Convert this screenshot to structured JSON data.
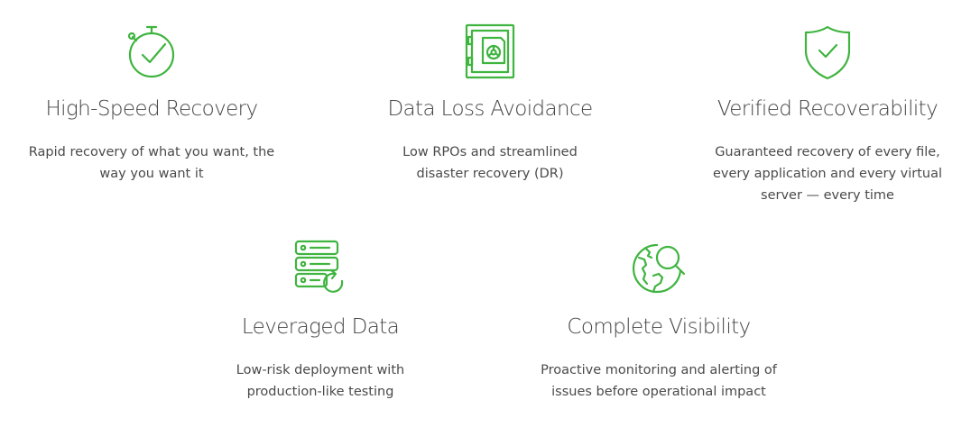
{
  "colors": {
    "accent": "#3fb43f",
    "title": "#444444",
    "text": "#4a4a4a",
    "background": "#ffffff"
  },
  "features": [
    {
      "icon": "stopwatch-check-icon",
      "title": "High-Speed Recovery",
      "description": "Rapid recovery of what you want, the way you want it"
    },
    {
      "icon": "vault-safe-icon",
      "title": "Data Loss Avoidance",
      "description": "Low RPOs and streamlined disaster recovery (DR)"
    },
    {
      "icon": "shield-check-icon",
      "title": "Verified Recoverability",
      "description": "Guaranteed recovery of every file, every application and every virtual server — every time"
    },
    {
      "icon": "server-stack-refresh-icon",
      "title": "Leveraged Data",
      "description": "Low-risk deployment with production-like testing"
    },
    {
      "icon": "globe-magnifier-icon",
      "title": "Complete Visibility",
      "description": "Proactive monitoring and alerting of issues before operational impact"
    }
  ]
}
